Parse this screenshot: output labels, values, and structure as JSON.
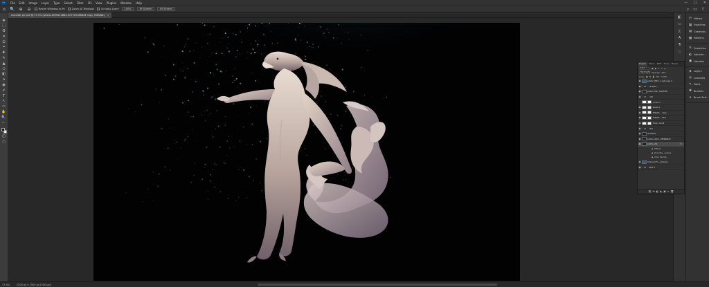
{
  "app": {
    "logo": "Ps"
  },
  "menu": [
    "File",
    "Edit",
    "Image",
    "Layer",
    "Type",
    "Select",
    "Filter",
    "3D",
    "View",
    "Plugins",
    "Window",
    "Help"
  ],
  "window_controls": [
    "—",
    "□",
    "✕"
  ],
  "options_bar": {
    "resize_windows_label": "Resize Windows to Fit",
    "zoom_all_label": "Zoom All Windows",
    "scrubby_zoom_label": "Scrubby Zoom",
    "zoom_100_label": "100%",
    "fit_screen_label": "Fit Screen",
    "fill_screen_label": "Fill Screen"
  },
  "document_tab": {
    "title": "monster ph.psd @ 37.5% (photo-1595213862-5277e0186843 copy, RGB/8#)",
    "close": "×"
  },
  "status": {
    "zoom": "37.5%",
    "info": "2500 px x 1500 px (300 ppi)"
  },
  "dock": {
    "group1": [
      {
        "icon": "history-icon",
        "glyph": "◷",
        "label": "History"
      },
      {
        "icon": "swatches-icon",
        "glyph": "▦",
        "label": "Swatches"
      },
      {
        "icon": "gradients-icon",
        "glyph": "▤",
        "label": "Gradients"
      },
      {
        "icon": "patterns-icon",
        "glyph": "▩",
        "label": "Patterns"
      }
    ],
    "group2": [
      {
        "icon": "properties-icon",
        "glyph": "≡",
        "label": "Properties"
      },
      {
        "icon": "adjustments-icon",
        "glyph": "◐",
        "label": "Adjustm..."
      },
      {
        "icon": "libraries-icon",
        "glyph": "▣",
        "label": "Libraries"
      }
    ],
    "group3": [
      {
        "icon": "layers-icon",
        "glyph": "◈",
        "label": "Layers"
      },
      {
        "icon": "channels-icon",
        "glyph": "◎",
        "label": "Channels"
      },
      {
        "icon": "paths-icon",
        "glyph": "✎",
        "label": "Paths"
      },
      {
        "icon": "brushes-icon",
        "glyph": "✱",
        "label": "Brushes"
      },
      {
        "icon": "brush-settings-icon",
        "glyph": "✦",
        "label": "Brush Sett..."
      }
    ]
  },
  "layers_panel": {
    "tabs": [
      "Layers",
      "Chan",
      "Path",
      "Brus",
      "Brush"
    ],
    "kind_label": "Kind",
    "blend_mode": "Hard Light",
    "opacity_label": "Opacity:",
    "opacity_value": "49%",
    "lock_label": "Lock:",
    "fill_label": "Fill:",
    "fill_value": "100%",
    "layers": [
      {
        "name": "photo-1595...1ce8 copy 2",
        "thumb": "blue",
        "eye": true
      },
      {
        "name": "shapes",
        "thumb": "folder",
        "eye": true
      },
      {
        "name": "photo-159...fe25f4f0",
        "thumb": "dark",
        "eye": true
      },
      {
        "name": "refl",
        "thumb": "folder",
        "eye": true
      },
      {
        "name": "Curve 1",
        "thumb": "w",
        "eye": false
      },
      {
        "name": "Level 1",
        "thumb": "w",
        "eye": true
      },
      {
        "name": "Bl&Wh... copy",
        "thumb": "w",
        "eye": true
      },
      {
        "name": "Bl&Wh... blue",
        "thumb": "w",
        "eye": true
      },
      {
        "name": "Hue/...tion1",
        "thumb": "w",
        "eye": true
      },
      {
        "name": "shb",
        "thumb": "folder",
        "eye": true
      },
      {
        "name": "lineMask",
        "thumb": "dark",
        "eye": true
      },
      {
        "name": "photo-1126...4f896849c",
        "thumb": "dark",
        "eye": true
      },
      {
        "name": "photo_shk",
        "thumb": "dark",
        "eye": true,
        "active": true,
        "fx": "fx"
      }
    ],
    "effects": [
      {
        "eye": "◉",
        "label": "Effects"
      },
      {
        "eye": "◉",
        "label": "Drop Sha...overlay"
      },
      {
        "eye": "◉",
        "label": "Color Overlay"
      }
    ],
    "bottom_layers": [
      {
        "name": "Channel Fo...(planes)",
        "thumb": "blue",
        "eye": true
      },
      {
        "name": "Bkd 1",
        "thumb": "folder",
        "eye": true
      }
    ],
    "footer": [
      "⛓",
      "fx",
      "◧",
      "◐",
      "▣",
      "+",
      "🗑"
    ]
  },
  "tools": [
    "✥",
    "⬚",
    "ʘ",
    "⌗",
    "⊡",
    "⌖",
    "✚",
    "✎",
    "▲",
    "⎔",
    "◧",
    "⌂",
    "◉",
    "✐",
    "T",
    "↖",
    "▭",
    "✋",
    "🔍",
    "⋯"
  ]
}
